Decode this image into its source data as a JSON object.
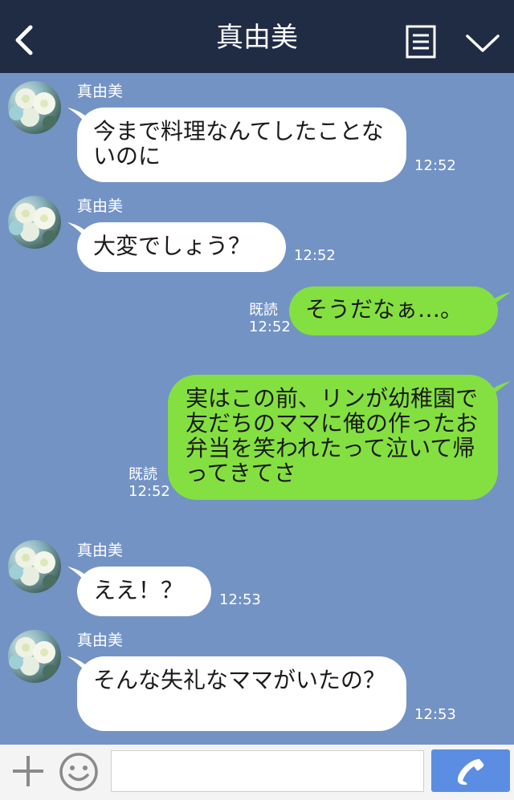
{
  "header": {
    "title": "真由美",
    "icons": [
      "back-chevron-icon",
      "memo-icon",
      "chevron-down-icon"
    ]
  },
  "messages": [
    {
      "sender": "真由美",
      "text": "今まで料理なんてしたことないのに",
      "time": "12:52",
      "direction": "in"
    },
    {
      "sender": "真由美",
      "text": "大変でしょう？",
      "time": "12:52",
      "direction": "in"
    },
    {
      "text": "そうだなぁ…。",
      "read": "既読",
      "time": "12:52",
      "direction": "out"
    },
    {
      "text": "実はこの前、リンが幼稚園で友だちのママに俺の作ったお弁当を笑われたって泣いて帰ってきてさ",
      "read": "既読",
      "time": "12:52",
      "direction": "out"
    },
    {
      "sender": "真由美",
      "text": "ええ！？",
      "time": "12:53",
      "direction": "in"
    },
    {
      "sender": "真由美",
      "text": "そんな失礼なママがいたの？",
      "time": "12:53",
      "direction": "in"
    }
  ],
  "footer": {
    "input_value": "",
    "icons": [
      "plus-icon",
      "smiley-icon",
      "phone-icon"
    ]
  },
  "colors": {
    "header_bg": "#202b44",
    "chat_bg": "#7393c4",
    "incoming_bubble": "#ffffff",
    "outgoing_bubble": "#84e041",
    "call_button": "#5b8ee2"
  }
}
